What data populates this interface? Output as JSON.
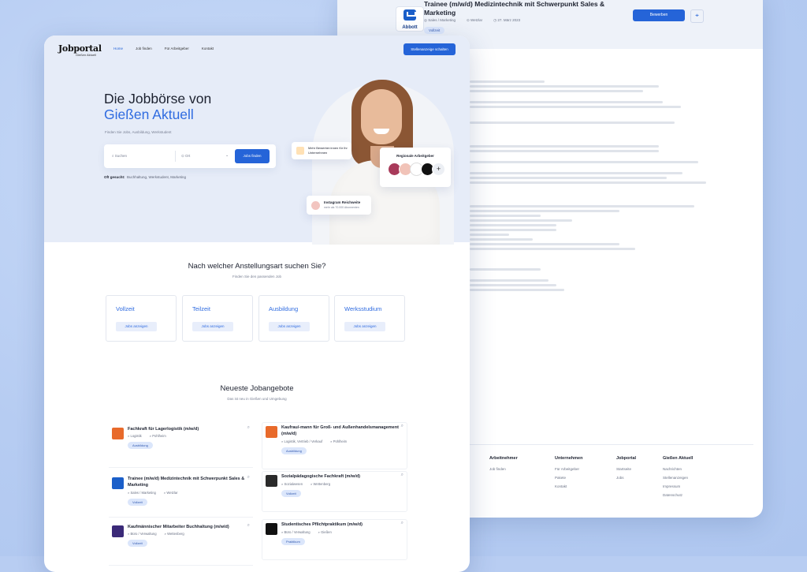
{
  "detail": {
    "title": "Trainee (m/w/d) Medizintechnik mit Schwerpunkt Sales & Marketing",
    "logo_label": "Abbott",
    "meta": [
      "Sales / Marketing",
      "Wetzlar",
      "27. März 2023"
    ],
    "tag": "Vollzeit",
    "apply_label": "Bewerben",
    "footer": {
      "arbeitnehmer": {
        "title": "Arbeitnehmer",
        "items": [
          "Job finden"
        ]
      },
      "unternehmen": {
        "title": "Unternehmen",
        "items": [
          "Für Arbeitgeber",
          "Pakete",
          "Kontakt"
        ]
      },
      "jobportal": {
        "title": "Jobportal",
        "items": [
          "Startseite",
          "Jobs"
        ]
      },
      "giessen": {
        "title": "Gießen Aktuell",
        "items": [
          "Nachrichten",
          "Stellenanzeigen",
          "Impressum",
          "Datenschutz"
        ]
      }
    }
  },
  "home": {
    "logo": {
      "main": "Jobportal",
      "sub": "Gießen Aktuell"
    },
    "nav": [
      "Home",
      "Job finden",
      "Für Arbeitgeber",
      "Kontakt"
    ],
    "nav_button": "Stellenanzeige schalten",
    "hero": {
      "title_line1": "Die Jobbörse von",
      "title_line2": "Gießen Aktuell",
      "subtitle": "Finden Sie Jobs, Ausbildung, Werkstudent",
      "search_placeholder": "Suchen",
      "location_placeholder": "Ort",
      "search_button": "Jobs finden",
      "often_label": "Oft gesucht:",
      "often_items": "Buchhaltung, Werkstudent, Marketing"
    },
    "chips": {
      "more_applicants": "Mehr Bewerber:innen für Ihr Unternehmen",
      "reach_title": "Instagram Reichweite",
      "reach_sub": "mehr als 70.000 Abonnenten",
      "regional": "Regionale Arbeitgeber"
    },
    "employment": {
      "title": "Nach welcher Anstellungsart suchen Sie?",
      "subtitle": "Finden Sie den passenden Job",
      "cards": [
        {
          "title": "Vollzeit",
          "button": "Jobs anzeigen"
        },
        {
          "title": "Teilzeit",
          "button": "Jobs anzeigen"
        },
        {
          "title": "Ausbildung",
          "button": "Jobs anzeigen"
        },
        {
          "title": "Werksstudium",
          "button": "Jobs anzeigen"
        }
      ]
    },
    "latest": {
      "title": "Neueste Jobangebote",
      "subtitle": "Das ist neu in Gießen und Umgebung",
      "jobs": [
        {
          "title": "Fachkraft für Lagerlogistik (m/w/d)",
          "category": "Logistik",
          "location": "Pohlheim",
          "tag": "Ausbildung",
          "logo_color": "#e86a2b"
        },
        {
          "title": "Kaufrau/-mann für Groß- und Außenhandelsmanagement (m/w/d)",
          "category": "Logistik, Vertrieb / Verkauf",
          "location": "Pohlheim",
          "tag": "Ausbildung",
          "logo_color": "#e86a2b"
        },
        {
          "title": "Trainee (m/w/d) Medizintechnik mit Schwerpunkt Sales & Marketing",
          "category": "Sales / Marketing",
          "location": "Wetzlar",
          "tag": "Vollzeit",
          "logo_color": "#1b5fc9"
        },
        {
          "title": "Sozialpädagogische Fachkraft (m/w/d)",
          "category": "Sozialwesen",
          "location": "Wettenberg",
          "tag": "Vollzeit",
          "logo_color": "#2a2a2a"
        },
        {
          "title": "Kaufmännischer Mitarbeiter Buchhaltung (m/w/d)",
          "category": "Büro / Verwaltung",
          "location": "Wettenberg",
          "tag": "Vollzeit",
          "logo_color": "#3b2a78"
        },
        {
          "title": "Studentisches Pflichtpraktikum (m/w/d)",
          "category": "Büro / Verwaltung",
          "location": "Gießen",
          "tag": "Praktikum",
          "logo_color": "#111111"
        }
      ]
    }
  }
}
